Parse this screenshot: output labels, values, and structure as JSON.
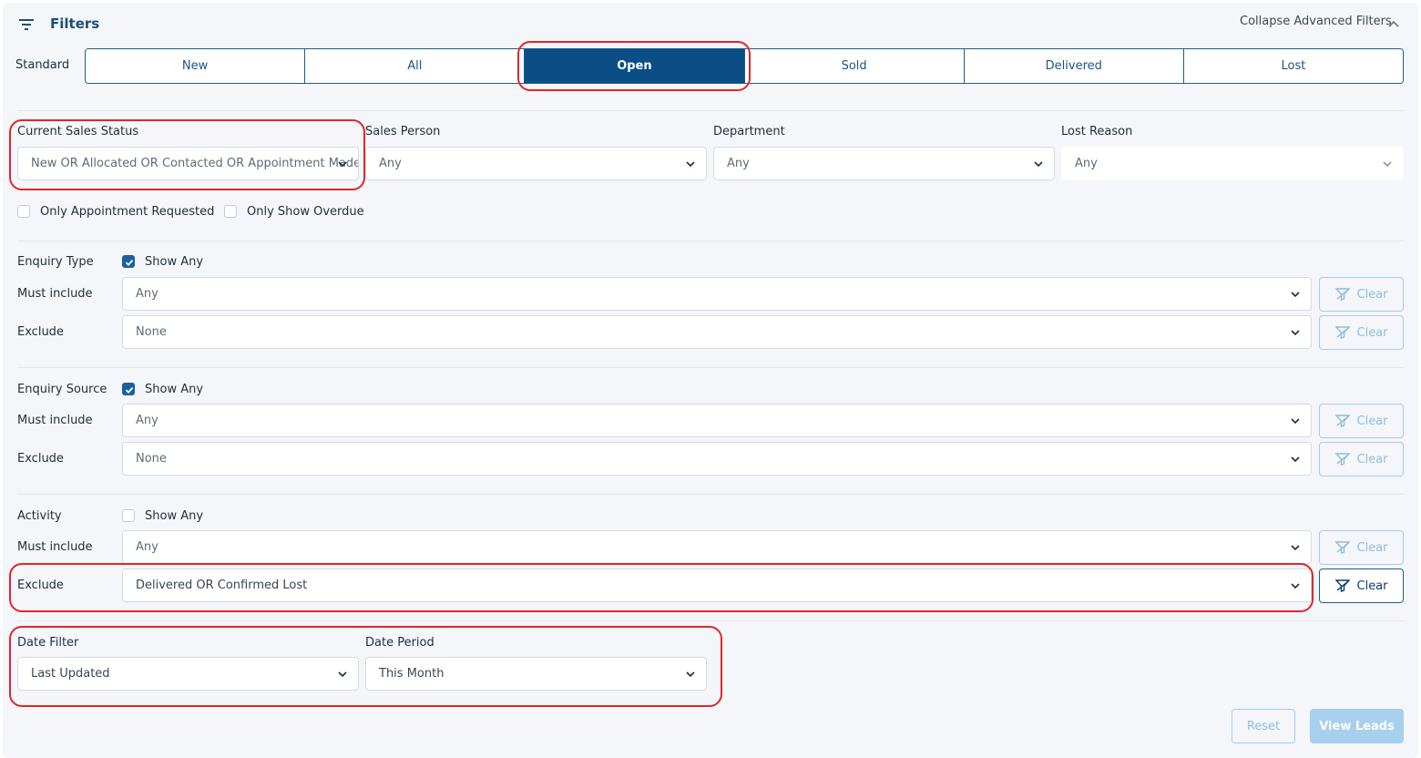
{
  "header": {
    "title": "Filters",
    "collapse_label": "Collapse Advanced Filters"
  },
  "standard": {
    "label": "Standard",
    "tabs": [
      "New",
      "All",
      "Open",
      "Sold",
      "Delivered",
      "Lost"
    ],
    "active": "Open"
  },
  "status_filters": {
    "current_sales_status": {
      "label": "Current Sales Status",
      "value": "New OR Allocated OR Contacted OR Appointment Made ..."
    },
    "sales_person": {
      "label": "Sales Person",
      "value": "Any"
    },
    "department": {
      "label": "Department",
      "value": "Any"
    },
    "lost_reason": {
      "label": "Lost Reason",
      "value": "Any"
    }
  },
  "checkboxes": {
    "appointment_requested": {
      "label": "Only Appointment Requested",
      "checked": false
    },
    "overdue": {
      "label": "Only Show Overdue",
      "checked": false
    }
  },
  "enquiry_type": {
    "label": "Enquiry Type",
    "show_any_label": "Show Any",
    "show_any": true,
    "must_include_label": "Must include",
    "must_include_value": "Any",
    "exclude_label": "Exclude",
    "exclude_value": "None",
    "clear_label": "Clear"
  },
  "enquiry_source": {
    "label": "Enquiry Source",
    "show_any_label": "Show Any",
    "show_any": true,
    "must_include_label": "Must include",
    "must_include_value": "Any",
    "exclude_label": "Exclude",
    "exclude_value": "None",
    "clear_label": "Clear"
  },
  "activity": {
    "label": "Activity",
    "show_any_label": "Show Any",
    "show_any": false,
    "must_include_label": "Must include",
    "must_include_value": "Any",
    "exclude_label": "Exclude",
    "exclude_value": "Delivered OR Confirmed Lost",
    "clear_label": "Clear"
  },
  "date": {
    "filter_label": "Date Filter",
    "filter_value": "Last Updated",
    "period_label": "Date Period",
    "period_value": "This Month"
  },
  "footer": {
    "reset_label": "Reset",
    "view_label": "View Leads"
  },
  "colors": {
    "primary": "#0a4e85",
    "annotation": "#e1262b",
    "disabled": "#8fbce0"
  }
}
